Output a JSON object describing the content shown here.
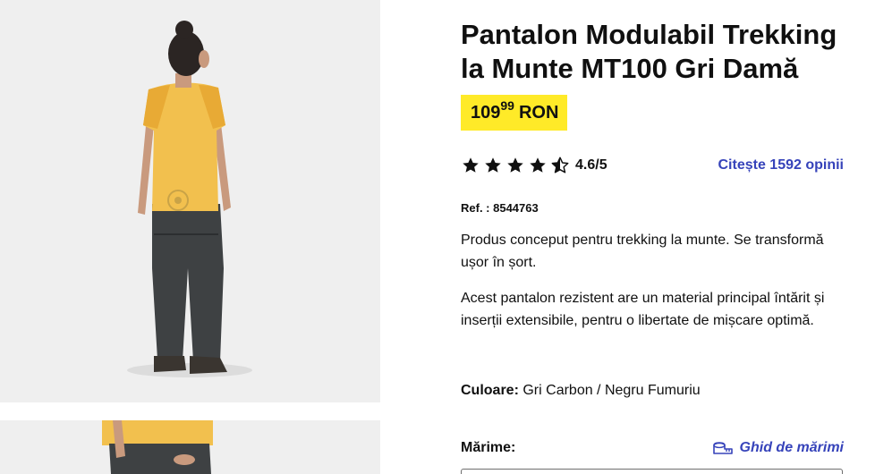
{
  "product": {
    "title": "Pantalon Modulabil Trekking la Munte MT100 Gri Damă",
    "price": {
      "integer": "109",
      "decimals": "99",
      "currency": "RON",
      "highlight_color": "#ffea28"
    },
    "rating": {
      "value": "4.6/5",
      "stars": 4.6,
      "max": 5
    },
    "reviews_link": "Citește 1592 opinii",
    "reference": "Ref. : 8544763",
    "description_short": "Produs conceput pentru trekking la munte. Se transformă ușor în șort.",
    "description_long": "Acest pantalon rezistent are un material principal întărit și inserții extensibile, pentru o libertate de mișcare optimă.",
    "color": {
      "label": "Culoare:",
      "value": "Gri Carbon / Negru Fumuriu"
    },
    "size": {
      "label": "Mărime:",
      "guide_link": "Ghid de mărimi",
      "guide_icon": "ruler-icon"
    }
  },
  "colors": {
    "link": "#3643ba",
    "text": "#101010",
    "photo_background": "#efefef"
  }
}
